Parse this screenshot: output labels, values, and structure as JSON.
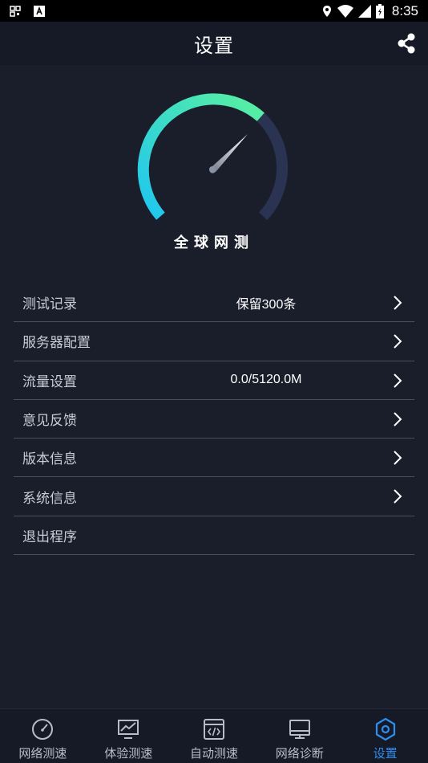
{
  "status_bar": {
    "time": "8:35",
    "icons": [
      "qr-icon",
      "a-icon",
      "location-icon",
      "wifi-icon",
      "signal-icon",
      "battery-icon"
    ]
  },
  "header": {
    "title": "设置",
    "share_icon": "share-icon"
  },
  "hero": {
    "brand": "全球网测",
    "gauge_colors": {
      "start": "#1fc6f0",
      "end": "#59f0a0",
      "track": "#2a3452"
    }
  },
  "menu": {
    "items": [
      {
        "label": "测试记录",
        "value": "保留300条",
        "chevron": true
      },
      {
        "label": "服务器配置",
        "value": "",
        "chevron": true
      },
      {
        "label": "流量设置",
        "value": "0.0/5120.0M",
        "chevron": true
      },
      {
        "label": "意见反馈",
        "value": "",
        "chevron": true
      },
      {
        "label": "版本信息",
        "value": "",
        "chevron": true
      },
      {
        "label": "系统信息",
        "value": "",
        "chevron": true
      },
      {
        "label": "退出程序",
        "value": "",
        "chevron": false
      }
    ]
  },
  "tabs": [
    {
      "label": "网络测速",
      "icon": "speedometer-icon",
      "active": false
    },
    {
      "label": "体验测速",
      "icon": "chart-monitor-icon",
      "active": false
    },
    {
      "label": "自动测速",
      "icon": "code-window-icon",
      "active": false
    },
    {
      "label": "网络诊断",
      "icon": "monitor-icon",
      "active": false
    },
    {
      "label": "设置",
      "icon": "settings-hexagon-icon",
      "active": true
    }
  ],
  "colors": {
    "background": "#1a1e2b",
    "accent": "#2e8ff0",
    "divider": "#4a4f5e"
  }
}
